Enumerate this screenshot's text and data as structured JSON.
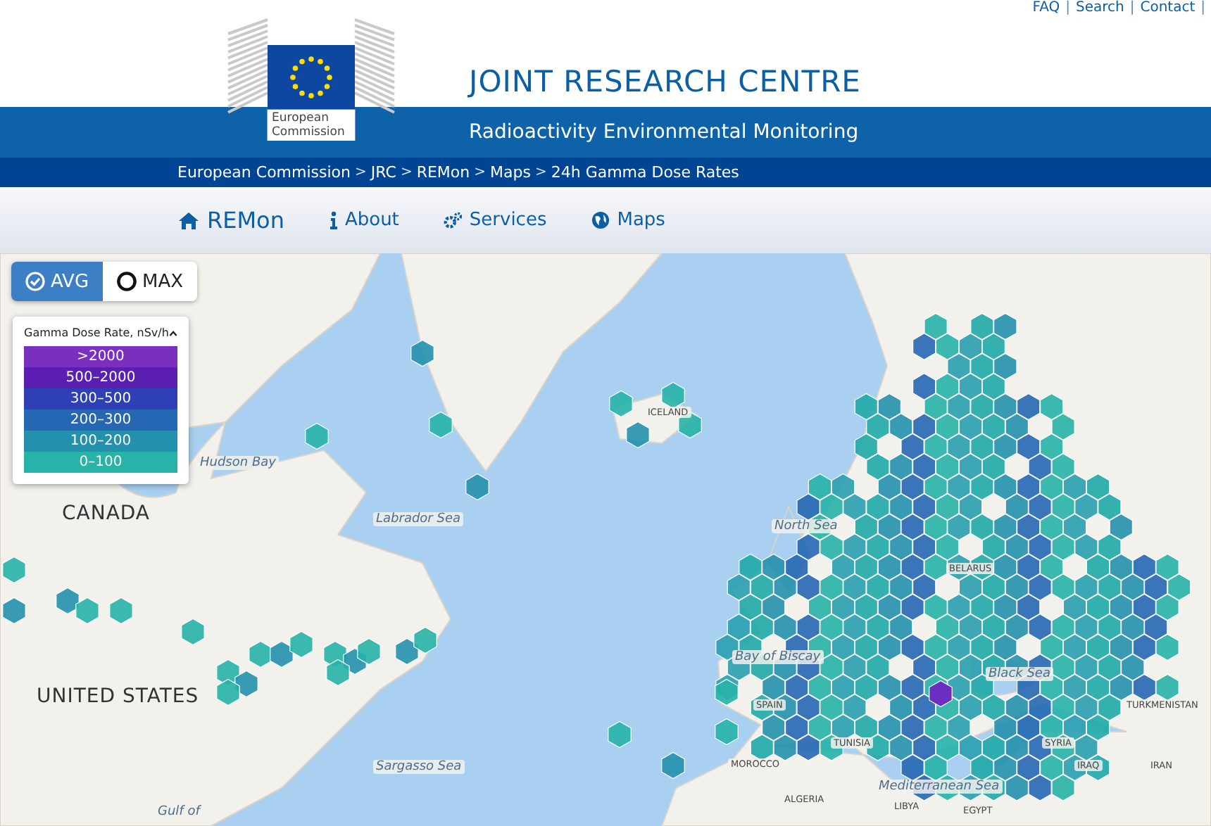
{
  "top_links": [
    {
      "text": "FAQ",
      "kind": "link"
    },
    {
      "text": "|",
      "kind": "separator"
    },
    {
      "text": "Search",
      "kind": "link"
    },
    {
      "text": "|",
      "kind": "separator"
    },
    {
      "text": "Contact",
      "kind": "link"
    },
    {
      "text": "|",
      "kind": "separator"
    }
  ],
  "logo": {
    "line1": "European",
    "line2": "Commission"
  },
  "header": {
    "title": "JOINT RESEARCH CENTRE",
    "subtitle": "Radioactivity Environmental Monitoring"
  },
  "breadcrumb": [
    {
      "text": "European Commission",
      "kind": "link"
    },
    {
      "text": ">",
      "kind": "separator"
    },
    {
      "text": "JRC",
      "kind": "link"
    },
    {
      "text": ">",
      "kind": "separator"
    },
    {
      "text": "REMon",
      "kind": "link"
    },
    {
      "text": ">",
      "kind": "separator"
    },
    {
      "text": "Maps",
      "kind": "link"
    },
    {
      "text": ">",
      "kind": "separator"
    },
    {
      "text": "24h Gamma Dose Rates",
      "kind": "link"
    }
  ],
  "nav": [
    {
      "label": "REMon",
      "kind": "home"
    },
    {
      "label": "About",
      "kind": "info"
    },
    {
      "label": "Services",
      "kind": "gears"
    },
    {
      "label": "Maps",
      "kind": "globe"
    }
  ],
  "mode_toggle": [
    {
      "label": "AVG",
      "selected": true
    },
    {
      "label": "MAX",
      "selected": false
    }
  ],
  "legend": {
    "title": "Gamma Dose Rate, nSv/h",
    "expanded": true,
    "items": [
      {
        "label": ">2000",
        "color": "#7b2fbf"
      },
      {
        "label": "500–2000",
        "color": "#5a1fb0"
      },
      {
        "label": "300–500",
        "color": "#2f3fb5"
      },
      {
        "label": "200–300",
        "color": "#2567b3"
      },
      {
        "label": "100–200",
        "color": "#2390ad"
      },
      {
        "label": "0–100",
        "color": "#27b3a8"
      }
    ]
  },
  "map_labels": [
    {
      "text": "Hudson Bay",
      "kind": "sea"
    },
    {
      "text": "CANADA",
      "kind": "country"
    },
    {
      "text": "Labrador Sea",
      "kind": "sea"
    },
    {
      "text": "UNITED STATES",
      "kind": "country"
    },
    {
      "text": "Sargasso Sea",
      "kind": "sea"
    },
    {
      "text": "Gulf of",
      "kind": "sea"
    },
    {
      "text": "ICELAND",
      "kind": "small"
    },
    {
      "text": "North Sea",
      "kind": "sea"
    },
    {
      "text": "BELARUS",
      "kind": "small"
    },
    {
      "text": "Bay of Biscay",
      "kind": "sea"
    },
    {
      "text": "SPAIN",
      "kind": "small"
    },
    {
      "text": "Black Sea",
      "kind": "sea"
    },
    {
      "text": "MOROCCO",
      "kind": "small"
    },
    {
      "text": "ALGERIA",
      "kind": "small"
    },
    {
      "text": "TUNISIA",
      "kind": "small"
    },
    {
      "text": "Mediterranean Sea",
      "kind": "sea"
    },
    {
      "text": "LIBYA",
      "kind": "small"
    },
    {
      "text": "EGYPT",
      "kind": "small"
    },
    {
      "text": "SYRIA",
      "kind": "small"
    },
    {
      "text": "IRAQ",
      "kind": "small"
    },
    {
      "text": "IRAN",
      "kind": "small"
    },
    {
      "text": "TURKMENISTAN",
      "kind": "small"
    }
  ]
}
